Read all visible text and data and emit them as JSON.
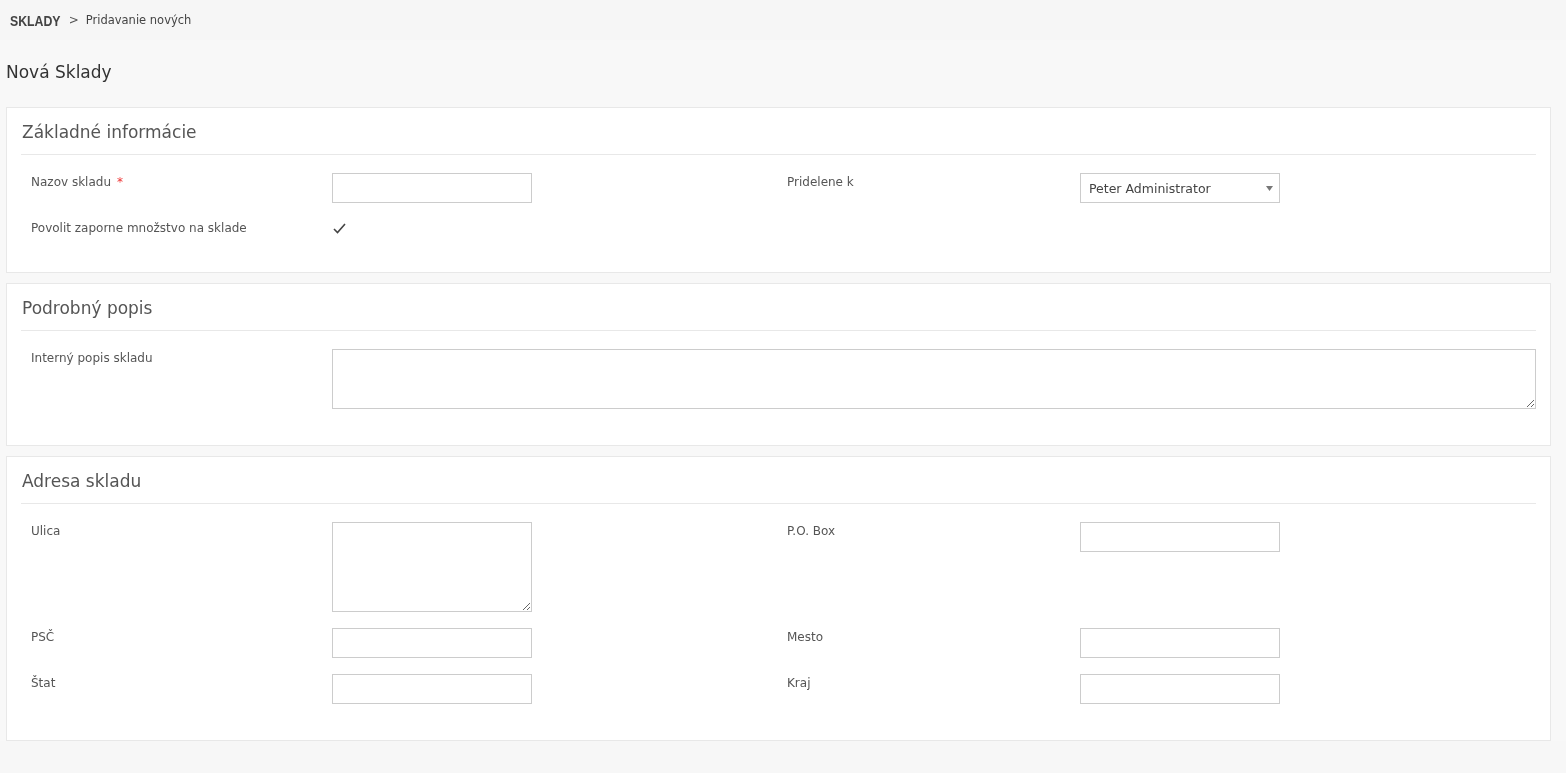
{
  "breadcrumb": {
    "root": "SKLADY",
    "separator": ">",
    "current": "Pridavanie nových"
  },
  "page_title": "Nová Sklady",
  "sections": [
    {
      "title": "Základné informácie",
      "rows": [
        [
          {
            "label": "Nazov skladu",
            "required_mark": "*",
            "kind": "text"
          },
          {
            "label": "Pridelene k",
            "kind": "select",
            "value": "Peter Administrator"
          }
        ],
        [
          {
            "label": "Povolit zaporne množstvo na sklade",
            "kind": "checkbox",
            "checked": true
          }
        ]
      ]
    },
    {
      "title": "Podrobný popis",
      "rows": [
        [
          {
            "label": "Interný popis skladu",
            "kind": "wide-textarea"
          }
        ]
      ]
    },
    {
      "title": "Adresa skladu",
      "rows": [
        [
          {
            "label": "Ulica",
            "kind": "textarea"
          },
          {
            "label": "P.O. Box",
            "kind": "text"
          }
        ],
        [
          {
            "label": "PSČ",
            "kind": "text"
          },
          {
            "label": "Mesto",
            "kind": "text"
          }
        ],
        [
          {
            "label": "Štat",
            "kind": "text"
          },
          {
            "label": "Kraj",
            "kind": "text"
          }
        ]
      ]
    }
  ]
}
